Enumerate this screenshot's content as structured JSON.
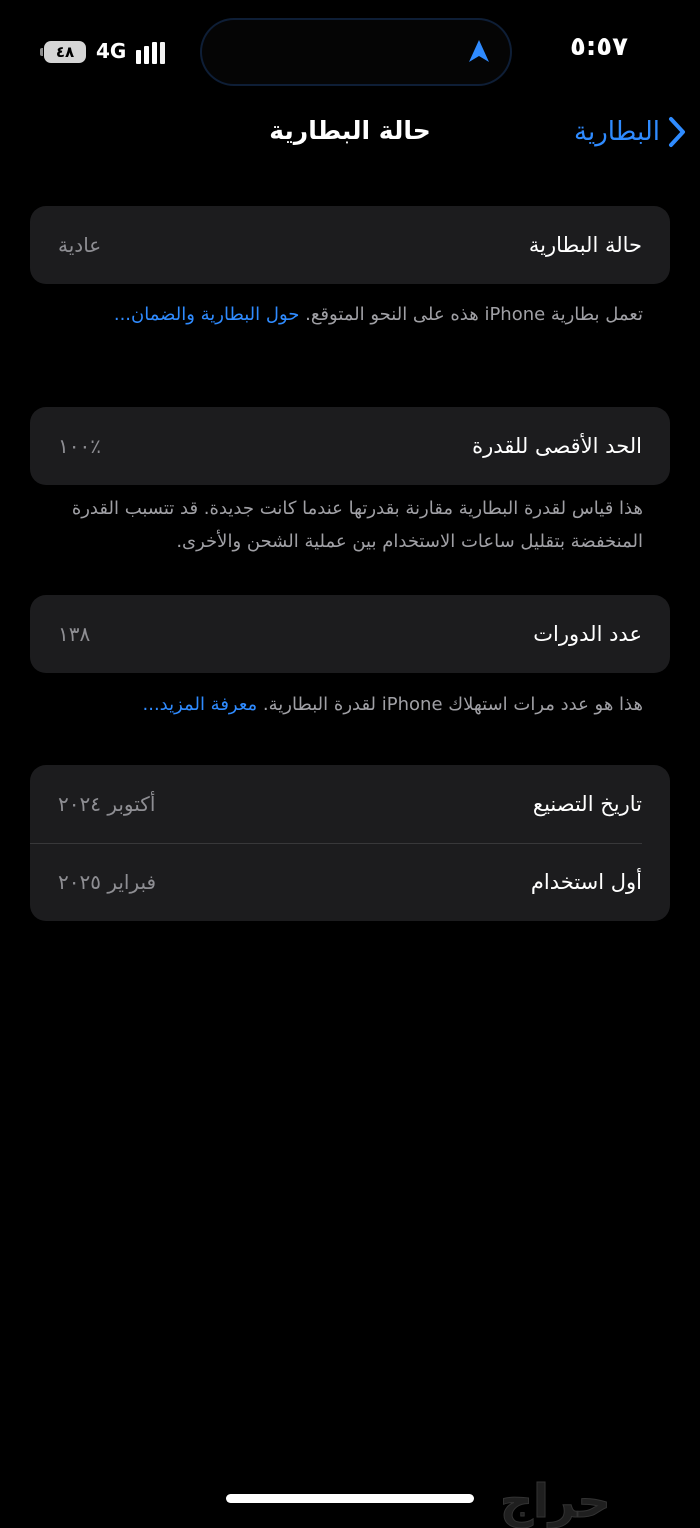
{
  "status_bar": {
    "time": "٥:٥٧",
    "battery": "٤٨",
    "network": "4G"
  },
  "nav": {
    "title": "حالة البطارية",
    "back_label": "البطارية"
  },
  "health_section": {
    "label": "حالة البطارية",
    "value": "عادية",
    "footnote_text": "تعمل بطارية iPhone هذه على النحو المتوقع.",
    "footnote_link": "حول البطارية والضمان..."
  },
  "capacity_section": {
    "label": "الحد الأقصى للقدرة",
    "value": "٪١٠٠",
    "footnote_text": "هذا قياس لقدرة البطارية مقارنة بقدرتها عندما كانت جديدة. قد تتسبب القدرة المنخفضة بتقليل ساعات الاستخدام بين عملية الشحن والأخرى."
  },
  "cycles_section": {
    "label": "عدد الدورات",
    "value": "١٣٨",
    "footnote_text": "هذا هو عدد مرات استهلاك iPhone لقدرة البطارية.",
    "footnote_link": "معرفة المزيد..."
  },
  "dates_section": {
    "rows": [
      {
        "label": "تاريخ التصنيع",
        "value": "أكتوبر ٢٠٢٤"
      },
      {
        "label": "أول استخدام",
        "value": "فبراير ٢٠٢٥"
      }
    ]
  },
  "watermark": "حراج",
  "colors": {
    "background": "#000000",
    "card": "#1c1c1e",
    "accent": "#2f8bff",
    "secondary_text": "#8e8e93"
  }
}
